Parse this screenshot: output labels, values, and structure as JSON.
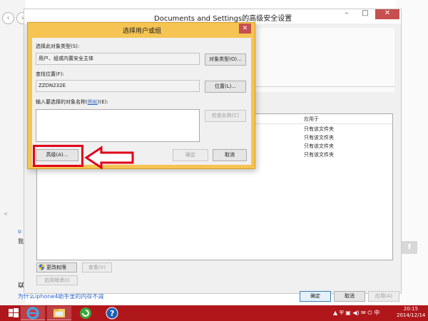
{
  "background": {
    "link1": "o",
    "text1": "我",
    "text2": "以",
    "link2": "为什么iphone4助手里的内存不减",
    "small_mark": "<"
  },
  "main_window": {
    "title": "Documents and Settings的高级安全设置",
    "perm_column_header": "应用于",
    "perm_rows": [
      "只有该文件夹",
      "只有该文件夹",
      "只有该文件夹",
      "只有该文件夹"
    ],
    "edit_perm_label": "更改权限",
    "view_label": "查看(V)",
    "inherit_label": "启用继承(I)",
    "ok_label": "确定",
    "cancel_label": "取消",
    "apply_label": "应用(A)"
  },
  "dialog": {
    "title": "选择用户或组",
    "object_type_label": "选择此对象类型(S):",
    "object_type_value": "用户、组或内置安全主体",
    "object_type_btn": "对象类型(O)...",
    "location_label": "查找位置(F):",
    "location_value": "ZZDN232E",
    "location_btn": "位置(L)...",
    "names_label_prefix": "输入要选择的对象名称(",
    "names_label_link": "例如",
    "names_label_suffix": ")(E):",
    "check_names_btn": "检查名称(C)",
    "advanced_btn": "高级(A)...",
    "ok_btn": "确定",
    "cancel_btn": "取消"
  },
  "taskbar": {
    "tray": "▲ ⛨ ▣ ◀) ✉ ⏻ 中",
    "clock_time": "20:15",
    "clock_date": "2014/12/14"
  },
  "colors": {
    "dialog_border": "#f6c453",
    "highlight": "#e0001a",
    "taskbar": "#b0171b"
  }
}
